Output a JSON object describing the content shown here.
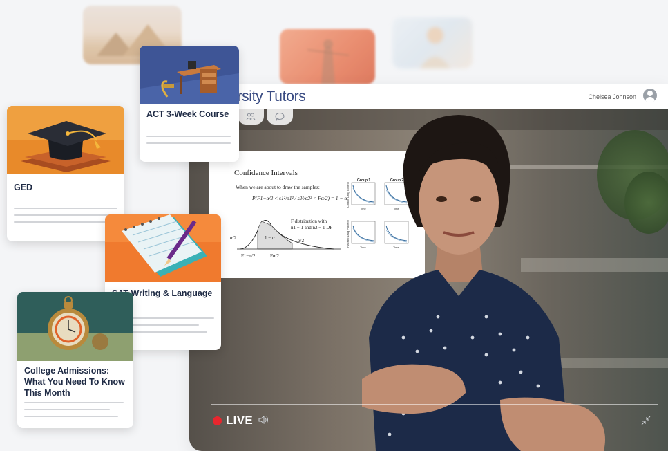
{
  "app": {
    "brand": "Varsity Tutors",
    "brand_visible": "arsity Tutors",
    "user_name": "Chelsea Johnson",
    "user_icon": "user-avatar-icon"
  },
  "toolbar": {
    "tabs": [
      {
        "icon": "participants-icon",
        "glyph": "ጸ"
      },
      {
        "icon": "chat-icon",
        "glyph": "◯"
      }
    ]
  },
  "slide": {
    "title": "Confidence Intervals",
    "intro": "When we are about to draw the samples:",
    "formula": "P(F1−α/2 < s1²/σ1² / s2²/σ2² < Fα/2) = 1 − α",
    "dist_note_line1": "F distribution with",
    "dist_note_line2": "n1 − 1 and n2 − 1 DF",
    "label_left": "α/2",
    "label_center": "1 − α",
    "label_right": "α/2",
    "label_f_low": "F1−α/2",
    "label_f_high": "Fα/2",
    "panels": [
      "Group 1",
      "Group 2"
    ],
    "axis_x": "Time",
    "axis_y_top": "Control Drug Control",
    "axis_y_bottom": "Placebo Drug Placebo"
  },
  "player": {
    "live_label": "LIVE",
    "live_color": "#e8262e",
    "volume_icon": "volume-icon",
    "minimize_icon": "minimize-icon"
  },
  "courses": [
    {
      "title": "ACT 3-Week Course",
      "icon": "desk-illustration"
    },
    {
      "title": "GED",
      "icon": "graduation-cap-illustration"
    },
    {
      "title": "SAT Writing & Language",
      "icon": "notepad-pencil-illustration"
    },
    {
      "title": "College Admissions: What You Need To Know This Month",
      "icon": "pocket-watch-illustration"
    }
  ],
  "colors": {
    "brand": "#3a4c83",
    "card_title": "#1f2b45",
    "page_bg": "#f4f5f7"
  }
}
